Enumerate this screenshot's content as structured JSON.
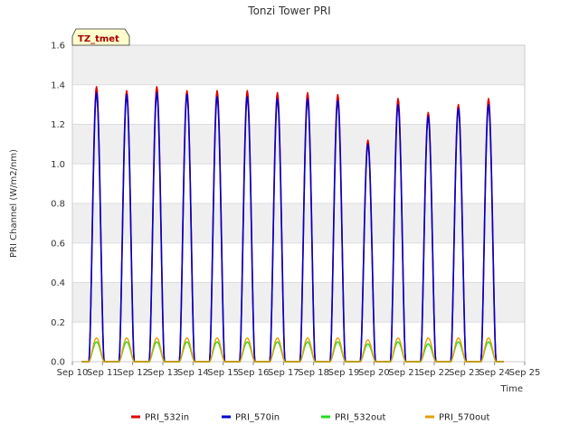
{
  "chart_data": {
    "type": "line",
    "title": "Tonzi Tower PRI",
    "xlabel": "Time",
    "ylabel": "PRI Channel (W/m2/nm)",
    "annotation": "TZ_tmet",
    "ylim": [
      0.0,
      1.6
    ],
    "y_ticks": [
      "0.0",
      "0.2",
      "0.4",
      "0.6",
      "0.8",
      "1.0",
      "1.2",
      "1.4",
      "1.6"
    ],
    "x_ticks": [
      "Sep 10",
      "Sep 11",
      "Sep 12",
      "Sep 13",
      "Sep 14",
      "Sep 15",
      "Sep 16",
      "Sep 17",
      "Sep 18",
      "Sep 19",
      "Sep 20",
      "Sep 21",
      "Sep 22",
      "Sep 23",
      "Sep 24",
      "Sep 25"
    ],
    "x_range_days": [
      10,
      25
    ],
    "x_unit": "day of September",
    "grid": true,
    "legend_position": "bottom",
    "daily_peak_day": [
      10.8,
      11.8,
      12.8,
      13.8,
      14.8,
      15.8,
      16.8,
      17.8,
      18.8,
      19.8,
      20.8,
      21.8,
      22.8,
      23.8
    ],
    "series": [
      {
        "name": "PRI_532in",
        "color": "#dd0000",
        "peaks": [
          1.39,
          1.37,
          1.39,
          1.37,
          1.37,
          1.37,
          1.36,
          1.36,
          1.35,
          1.12,
          1.33,
          1.26,
          1.3,
          1.33
        ]
      },
      {
        "name": "PRI_570in",
        "color": "#0000cc",
        "peaks": [
          1.36,
          1.35,
          1.36,
          1.35,
          1.34,
          1.34,
          1.33,
          1.33,
          1.32,
          1.1,
          1.3,
          1.24,
          1.28,
          1.3
        ]
      },
      {
        "name": "PRI_532out",
        "color": "#22dd22",
        "peaks": [
          0.1,
          0.1,
          0.1,
          0.1,
          0.1,
          0.1,
          0.1,
          0.1,
          0.1,
          0.09,
          0.1,
          0.09,
          0.1,
          0.1
        ]
      },
      {
        "name": "PRI_570out",
        "color": "#e6a000",
        "peaks": [
          0.12,
          0.12,
          0.12,
          0.12,
          0.12,
          0.12,
          0.12,
          0.12,
          0.12,
          0.11,
          0.12,
          0.12,
          0.12,
          0.12
        ]
      }
    ]
  }
}
